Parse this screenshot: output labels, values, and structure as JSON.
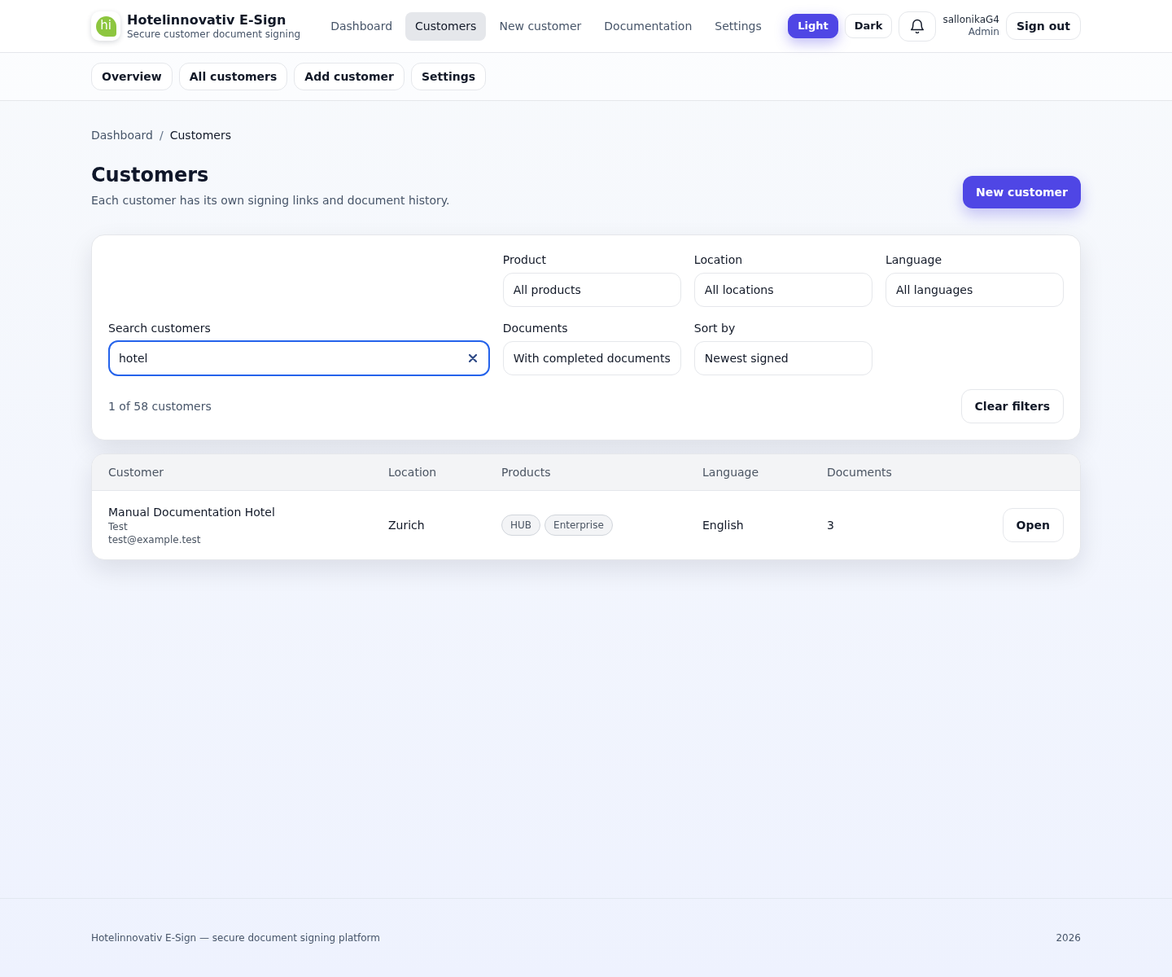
{
  "brand": {
    "logo_text": "hi",
    "title": "Hotelinnovativ E-Sign",
    "subtitle": "Secure customer document signing"
  },
  "nav": [
    {
      "label": "Dashboard",
      "selected": false
    },
    {
      "label": "Customers",
      "selected": true
    },
    {
      "label": "New customer",
      "selected": false
    },
    {
      "label": "Documentation",
      "selected": false
    },
    {
      "label": "Settings",
      "selected": false
    }
  ],
  "theme_toggle": [
    {
      "label": "Light",
      "selected": true
    },
    {
      "label": "Dark",
      "selected": false
    }
  ],
  "user": {
    "name": "sallonikaG4",
    "role": "Admin"
  },
  "sign_out": "Sign out",
  "subnav": [
    "Overview",
    "All customers",
    "Add customer",
    "Settings"
  ],
  "breadcrumb": {
    "separator": "/",
    "items": [
      {
        "label": "Dashboard",
        "current": false
      },
      {
        "label": "Customers",
        "current": true
      }
    ]
  },
  "page": {
    "title": "Customers",
    "subtitle": "Each customer has its own signing links and document history.",
    "action": "New customer"
  },
  "filters_panel": {
    "search": {
      "label": "Search customers",
      "value": "hotel",
      "focused": true
    },
    "filters": [
      {
        "label": "Product",
        "value": "All products"
      },
      {
        "label": "Location",
        "value": "All locations"
      },
      {
        "label": "Language",
        "value": "All languages"
      },
      {
        "label": "Documents",
        "value": "With completed documents"
      },
      {
        "label": "Sort by",
        "value": "Newest signed"
      }
    ],
    "result_count": "1 of 58 customers",
    "clear_button": "Clear filters"
  },
  "table": {
    "columns": [
      "Customer",
      "Location",
      "Products",
      "Language",
      "Documents"
    ],
    "rows": [
      {
        "name": "Manual Documentation Hotel",
        "contact": "Test",
        "email": "test@example.test",
        "location": "Zurich",
        "products": [
          "HUB",
          "Enterprise"
        ],
        "language": "English",
        "documents": "3",
        "action": "Open"
      }
    ]
  },
  "footer": {
    "text": "Hotelinnovativ E-Sign — secure document signing platform",
    "year": "2026"
  }
}
